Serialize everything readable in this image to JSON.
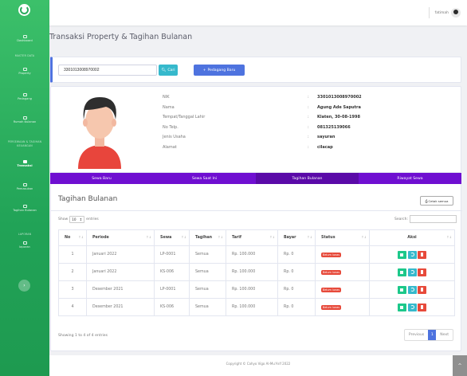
{
  "sidebar": {
    "dashboard": "Dashboard",
    "heading_master": "MASTER DATA",
    "property": "Property",
    "pedagang": "Pedagang",
    "heading_keuangan": "PERSEWAAN & TAGIHAN KEUANGAN",
    "rumah_bulanan": "Rumah Bulanan",
    "transaksi": "Transaksi",
    "pemasukan": "Pemasukan",
    "tagihan_bulanan": "Tagihan Bulanan",
    "heading_laporan": "LAPORAN",
    "laporan": "laporan"
  },
  "topbar": {
    "user_name": "fatimah"
  },
  "page_title": "Transaksi Property & Tagihan Bulanan",
  "search": {
    "value": "3301013008970002",
    "cari_label": "Cari",
    "tambah_label": "Pedagang Baru"
  },
  "profile": {
    "rows": [
      {
        "label": "NIK",
        "value": "3301013008970002"
      },
      {
        "label": "Nama",
        "value": "Agung Ade Saputra"
      },
      {
        "label": "Tempat/Tanggal Lahir",
        "value": "Klaten, 30-08-1998"
      },
      {
        "label": "No Telp.",
        "value": "081325139066"
      },
      {
        "label": "Jenis Usaha",
        "value": "sayuran"
      },
      {
        "label": "Alamat",
        "value": "cilacap"
      }
    ],
    "separator": ":"
  },
  "tabs": [
    "Sewa Baru",
    "Sewa Saat Ini",
    "Tagihan Bulanan",
    "Riwayat Sewa"
  ],
  "active_tab": "Tagihan Bulanan",
  "tagihan": {
    "title": "Tagihan Bulanan",
    "cetak_label": "Cetak semua",
    "show_label": "Show",
    "show_value": "10",
    "entries_label": "entries",
    "search_label": "Search:",
    "columns": [
      "No",
      "Periode",
      "Sewa",
      "Tagihan",
      "Tarif",
      "Bayar",
      "Status",
      "Aksi"
    ],
    "rows": [
      {
        "no": "1",
        "periode": "Januari 2022",
        "sewa": "LP-0001",
        "tagihan": "Semua",
        "tarif": "Rp. 100.000",
        "bayar": "Rp. 0",
        "status": "Belum lunas"
      },
      {
        "no": "2",
        "periode": "Januari 2022",
        "sewa": "KS-006",
        "tagihan": "Semua",
        "tarif": "Rp. 100.000",
        "bayar": "Rp. 0",
        "status": "Belum lunas"
      },
      {
        "no": "3",
        "periode": "Desember 2021",
        "sewa": "LP-0001",
        "tagihan": "Semua",
        "tarif": "Rp. 100.000",
        "bayar": "Rp. 0",
        "status": "Belum lunas"
      },
      {
        "no": "4",
        "periode": "Desember 2021",
        "sewa": "KS-006",
        "tagihan": "Semua",
        "tarif": "Rp. 100.000",
        "bayar": "Rp. 0",
        "status": "Belum lunas"
      }
    ],
    "showing": "Showing 1 to 4 of 4 entries",
    "prev_label": "Previous",
    "page": "1",
    "next_label": "Next"
  },
  "footer": "Copyright © Cahyo Vigo Al-Mu'Arif 2022",
  "colors": {
    "sidebar": "#21a357",
    "tabs": "#6f0fd1",
    "primary": "#4e73df",
    "danger": "#e74a3b"
  }
}
